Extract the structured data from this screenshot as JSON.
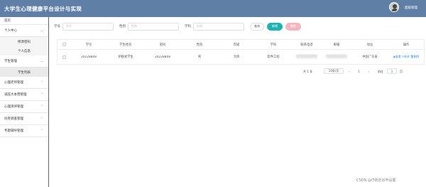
{
  "header": {
    "title": "大学生心理健康平台设计与实现",
    "user": "超级管理"
  },
  "sidebar": {
    "home": "首页",
    "groups": [
      {
        "label": "个人中心",
        "subs": [
          "修改密码",
          "个人信息"
        ]
      },
      {
        "label": "学生管理",
        "subs": [
          "学生列表"
        ]
      },
      {
        "label": "心理老师管理",
        "subs": []
      },
      {
        "label": "减压大本营管理",
        "subs": []
      },
      {
        "label": "心理测评管理",
        "subs": []
      },
      {
        "label": "问卷调查管理",
        "subs": []
      },
      {
        "label": "专题辅导管理",
        "subs": []
      }
    ]
  },
  "search": {
    "fields": [
      {
        "label": "学号",
        "placeholder": "学号"
      },
      {
        "label": "性别",
        "placeholder": "性别"
      },
      {
        "label": "学科",
        "placeholder": "学科"
      }
    ],
    "query": "查询",
    "add": "新增",
    "delete": "删除"
  },
  "table": {
    "headers": [
      "学号",
      "学生姓名",
      "密码",
      "性别",
      "年级",
      "学科",
      "联系电话",
      "邮箱",
      "住址",
      "操作"
    ],
    "rows": [
      [
        "20228808",
        "护眼式学生",
        "20228808",
        "男",
        "大四",
        "软件工程",
        "",
        "",
        "中国广东省",
        ""
      ]
    ],
    "ops": [
      "查看",
      "修改",
      "删除"
    ]
  },
  "pager": {
    "total": "共 1 条",
    "size": "10条/页",
    "page": "1",
    "goto": "前往",
    "goto_page": "1",
    "suffix": "页"
  },
  "watermark": "CSDN @IT跃迁谷毕设展"
}
